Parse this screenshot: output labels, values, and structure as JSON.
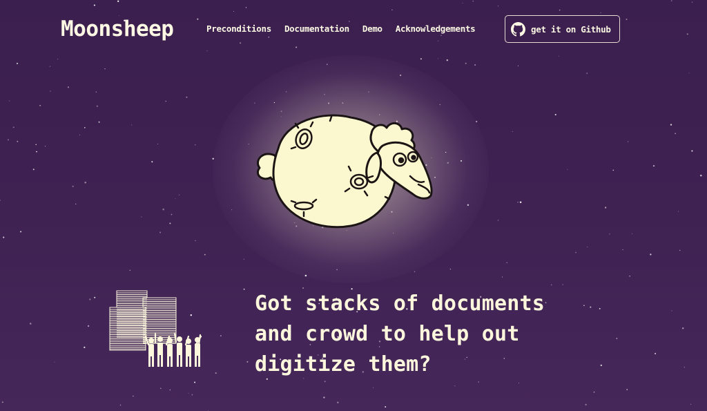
{
  "brand": {
    "name": "Moonsheep"
  },
  "nav": {
    "links": [
      {
        "label": "Preconditions"
      },
      {
        "label": "Documentation"
      },
      {
        "label": "Demo"
      },
      {
        "label": "Acknowledgements"
      }
    ],
    "github_button": {
      "label": "get it on Github",
      "icon": "github-icon"
    }
  },
  "hero": {
    "headline_lines": [
      "Got stacks of documents",
      "and crowd to help out",
      "digitize them?"
    ],
    "illustration": "document-stacks-and-crowd-illustration",
    "mascot": "moon-sheep-illustration"
  },
  "colors": {
    "background": "#3e2150",
    "text": "#fbf6dc",
    "moon": "#fbf7cf",
    "outline": "#1b1414"
  }
}
